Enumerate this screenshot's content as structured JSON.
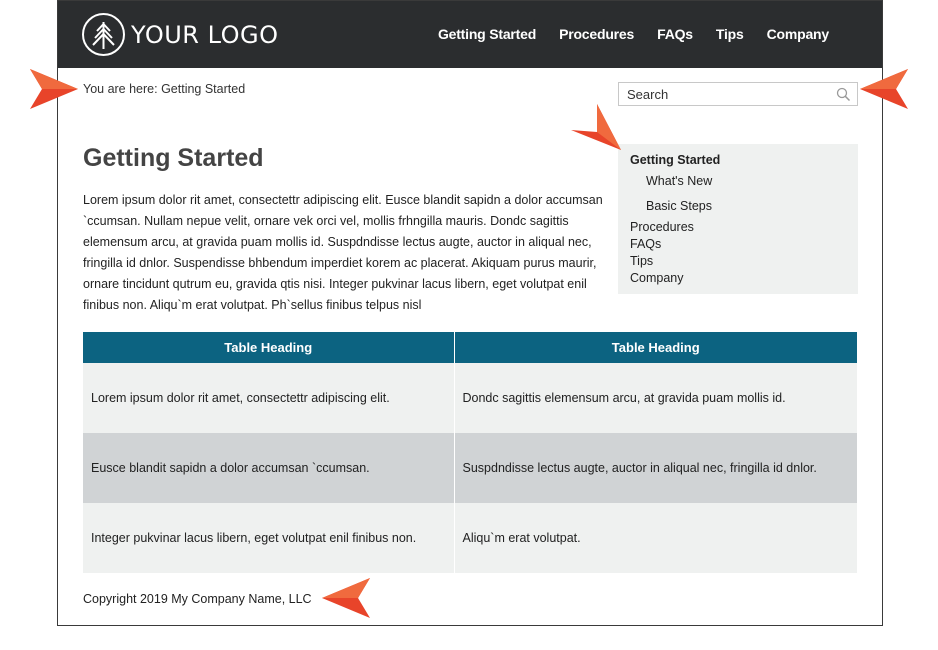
{
  "header": {
    "logo_text": "YOUR LOGO",
    "nav": [
      "Getting Started",
      "Procedures",
      "FAQs",
      "Tips",
      "Company"
    ]
  },
  "breadcrumb": "You are here: Getting Started",
  "search": {
    "placeholder": "Search"
  },
  "side_menu": {
    "active": "Getting Started",
    "sub_items": [
      "What's New",
      "Basic Steps"
    ],
    "items": [
      "Procedures",
      "FAQs",
      "Tips",
      "Company"
    ]
  },
  "page": {
    "title": "Getting Started",
    "body": "Lorem ipsum dolor rit amet, consectettr adipiscing elit. Eusce blandit sapidn a dolor accumsan `ccumsan. Nullam nepue velit, ornare vek orci vel, mollis frhngilla mauris. Dondc sagittis elemensum arcu, at gravida puam mollis id. Suspdndisse lectus augte, auctor in aliqual nec, fringilla id dnlor. Suspendisse bhbendum imperdiet korem ac placerat. Akiquam purus maurir, ornare tincidunt qutrum eu, gravida qtis nisi. Integer pukvinar lacus libern, eget volutpat enil finibus non. Aliqu`m erat volutpat. Ph`sellus finibus telpus nisl"
  },
  "table": {
    "headers": [
      "Table Heading",
      "Table Heading"
    ],
    "rows": [
      [
        "Lorem ipsum dolor rit amet, consectettr adipiscing elit.",
        "Dondc sagittis elemensum arcu, at gravida puam mollis id."
      ],
      [
        "Eusce blandit sapidn a dolor accumsan `ccumsan.",
        "Suspdndisse lectus augte, auctor in aliqual nec, fringilla id dnlor."
      ],
      [
        "Integer pukvinar lacus libern, eget volutpat enil finibus non.",
        "Aliqu`m erat volutpat."
      ]
    ]
  },
  "footer": "Copyright 2019 My Company Name, LLC",
  "colors": {
    "topbar": "#2b2d2f",
    "table_header": "#0c6381",
    "row_light": "#eff1f0",
    "row_dark": "#d0d3d5",
    "callout_arrow": "#e8442a"
  }
}
